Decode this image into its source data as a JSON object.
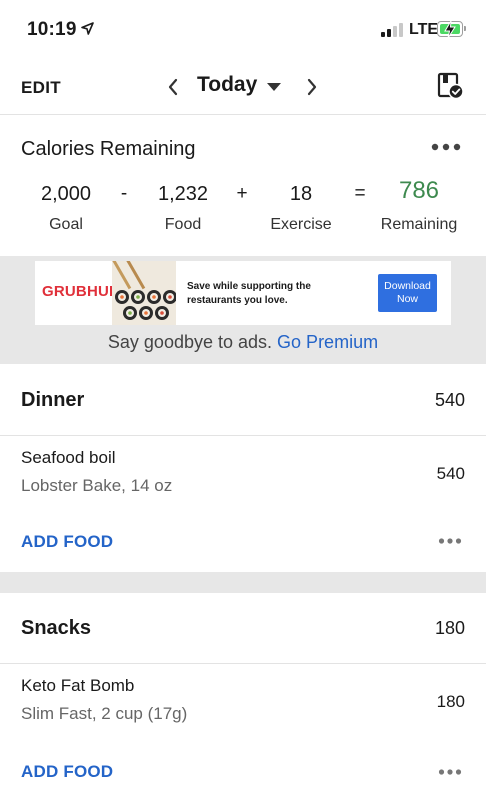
{
  "status_bar": {
    "time": "10:19",
    "network": "LTE"
  },
  "nav": {
    "edit_label": "EDIT",
    "date_label": "Today"
  },
  "calories": {
    "title": "Calories Remaining",
    "goal_value": "2,000",
    "goal_label": "Goal",
    "minus": "-",
    "food_value": "1,232",
    "food_label": "Food",
    "plus": "+",
    "exercise_value": "18",
    "exercise_label": "Exercise",
    "equals": "=",
    "remaining_value": "786",
    "remaining_label": "Remaining",
    "remaining_color": "#3e8a4f"
  },
  "ad": {
    "brand": "GRUBHUB",
    "text": "Save while supporting the restaurants you love.",
    "cta": "Download Now",
    "goodbye_text": "Say goodbye to ads.",
    "premium_link": "Go Premium"
  },
  "meals": [
    {
      "title": "Dinner",
      "calories": "540",
      "items": [
        {
          "name": "Seafood boil",
          "detail": "Lobster  Bake, 14 oz",
          "calories": "540"
        }
      ],
      "add_label": "ADD FOOD"
    },
    {
      "title": "Snacks",
      "calories": "180",
      "items": [
        {
          "name": "Keto Fat Bomb",
          "detail": "Slim Fast, 2 cup (17g)",
          "calories": "180"
        }
      ],
      "add_label": "ADD FOOD"
    }
  ],
  "icons": [
    "location-arrow-icon",
    "signal-icon",
    "battery-charging-icon",
    "chevron-left-icon",
    "caret-down-icon",
    "chevron-right-icon",
    "diary-complete-icon",
    "more-icon"
  ],
  "colors": {
    "accent_blue": "#2464c8",
    "remaining_green": "#3e8a4f",
    "ad_red": "#e0303a"
  }
}
